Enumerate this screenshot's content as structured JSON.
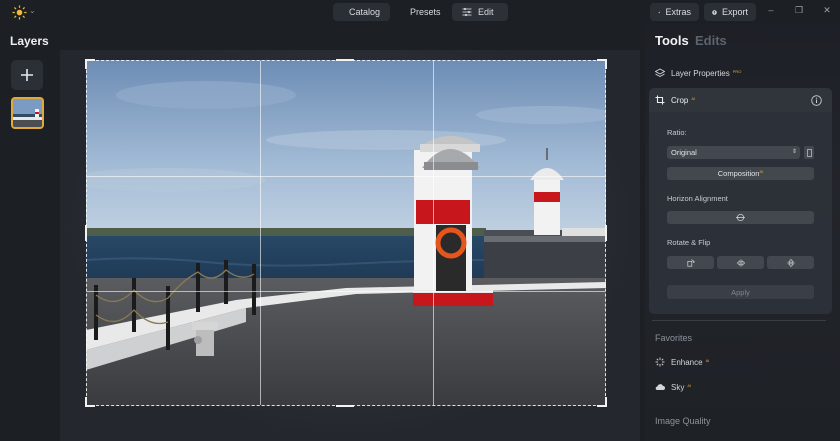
{
  "topbar": {
    "logo": "sun-logo-icon",
    "nav": [
      {
        "label": "Catalog",
        "icon": "folder-icon"
      },
      {
        "label": "Presets",
        "icon": "sparkle-icon"
      },
      {
        "label": "Edit",
        "icon": "sliders-icon"
      }
    ],
    "extras_label": "Extras",
    "export_label": "Export",
    "window_controls": {
      "minimize": "–",
      "maximize": "❐",
      "close": "✕"
    }
  },
  "layers": {
    "title": "Layers",
    "add_icon": "plus-icon"
  },
  "panel": {
    "tabs": {
      "tools": "Tools",
      "edits": "Edits"
    },
    "layer_properties": {
      "label": "Layer Properties",
      "tag": "PRO"
    },
    "crop": {
      "label": "Crop",
      "tag": "AI",
      "ratio_label": "Ratio:",
      "ratio_value": "Original",
      "composition_label": "Composition",
      "composition_tag": "AI",
      "horizon_label": "Horizon Alignment",
      "rotate_flip_label": "Rotate & Flip",
      "apply_label": "Apply"
    },
    "favorites_title": "Favorites",
    "favorites": [
      {
        "label": "Enhance",
        "tag": "AI",
        "icon": "enhance-icon"
      },
      {
        "label": "Sky",
        "tag": "AI",
        "icon": "cloud-icon"
      }
    ],
    "image_quality_title": "Image Quality"
  },
  "colors": {
    "accent": "#e0a93a",
    "background": "#1c1f24",
    "lighthouse_red": "#c7161c"
  }
}
